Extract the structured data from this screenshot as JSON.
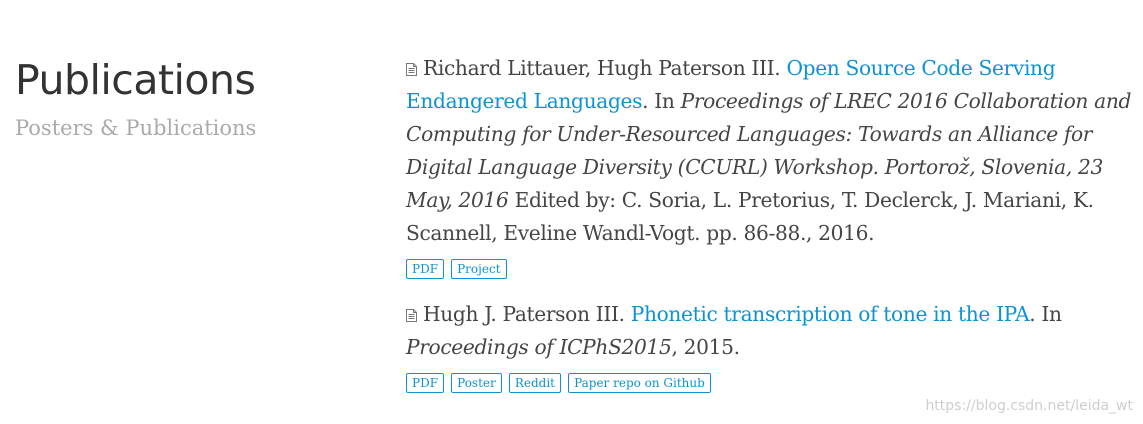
{
  "header": {
    "title": "Publications",
    "subtitle": "Posters & Publications"
  },
  "publications": [
    {
      "authors": "Richard Littauer, Hugh Paterson III. ",
      "title": "Open Source Code Serving Endangered Languages",
      "in_prefix": ". In ",
      "venue": "Proceedings of LREC 2016 Collaboration and Computing for Under-Resourced Languages: Towards an Alliance for Digital Language Diversity (CCURL) Workshop. Portorož, Slovenia, 23 May, 2016",
      "rest": " Edited by: C. Soria, L. Pretorius, T. Declerck, J. Mariani, K. Scannell, Eveline Wandl-Vogt. pp. 86-88., 2016.",
      "links": [
        "PDF",
        "Project"
      ]
    },
    {
      "authors": "Hugh J. Paterson III. ",
      "title": "Phonetic transcription of tone in the IPA",
      "in_prefix": ". In ",
      "venue": "Proceedings of ICPhS2015",
      "rest": ", 2015.",
      "links": [
        "PDF",
        "Poster",
        "Reddit",
        "Paper repo on Github"
      ]
    }
  ],
  "icons": {
    "publication": "document-icon"
  },
  "colors": {
    "link": "#0c93d4",
    "text": "#454545",
    "title": "#333333",
    "subtitle": "#aaaaaa"
  },
  "watermark": "https://blog.csdn.net/leida_wt"
}
